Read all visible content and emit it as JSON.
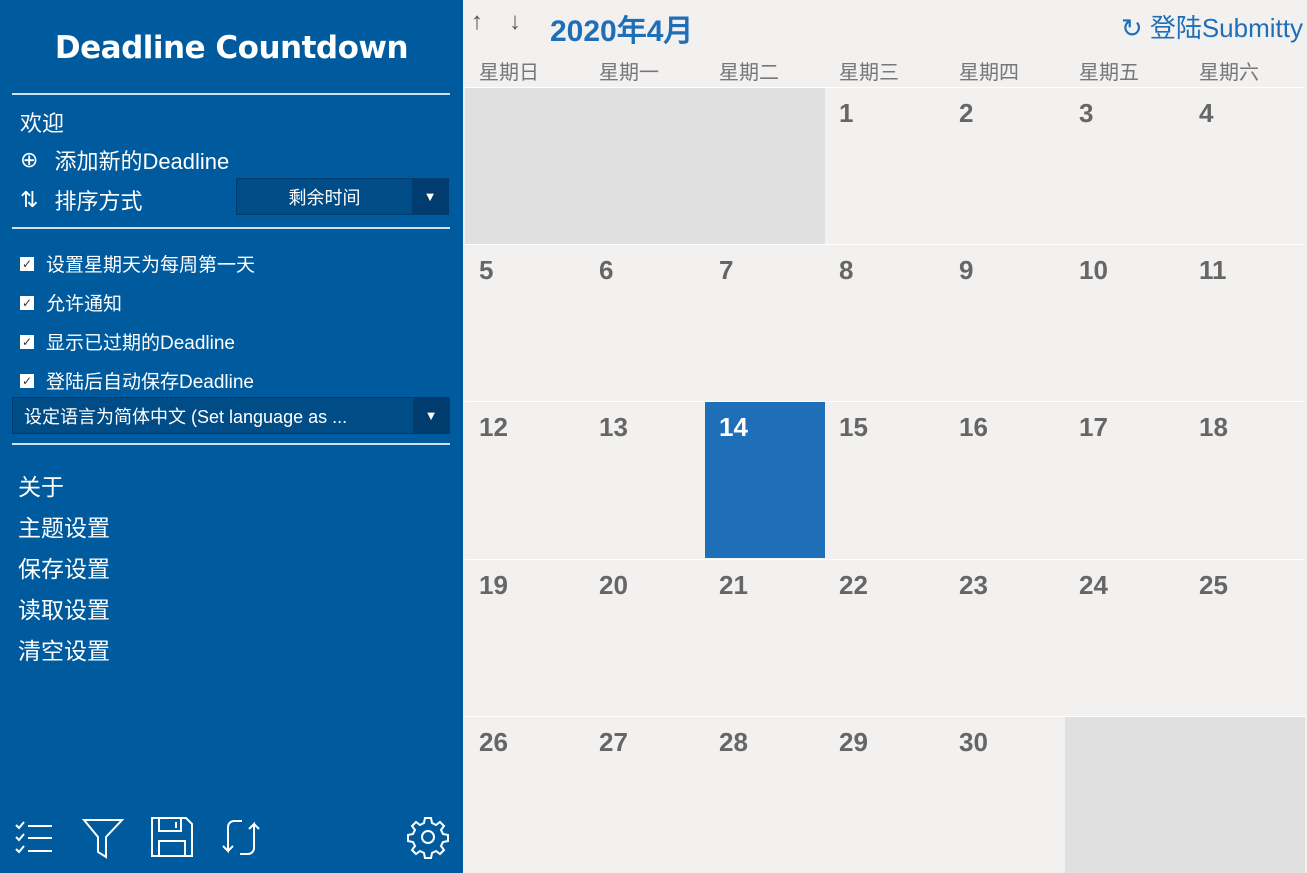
{
  "sidebar": {
    "title": "Deadline Countdown",
    "welcome": "欢迎",
    "add_deadline": "添加新的Deadline",
    "sort_label": "排序方式",
    "sort_value": "剩余时间",
    "options": [
      {
        "label": "设置星期天为每周第一天",
        "checked": true
      },
      {
        "label": "允许通知",
        "checked": true
      },
      {
        "label": "显示已过期的Deadline",
        "checked": true
      },
      {
        "label": "登陆后自动保存Deadline",
        "checked": true
      }
    ],
    "language_value": "设定语言为简体中文 (Set language as ...",
    "links": [
      "关于",
      "主题设置",
      "保存设置",
      "读取设置",
      "清空设置"
    ],
    "bottom_icons": [
      "checklist-icon",
      "filter-icon",
      "save-icon",
      "sync-icon",
      "gear-icon"
    ],
    "color": "#005a9e"
  },
  "calendar": {
    "month_title": "2020年4月",
    "login_label": "登陆Submitty",
    "weekdays": [
      "星期日",
      "星期一",
      "星期二",
      "星期三",
      "星期四",
      "星期五",
      "星期六"
    ],
    "leading_blank_days": 3,
    "days_in_month": 30,
    "today": 14,
    "accent": "#1e6eb8"
  }
}
